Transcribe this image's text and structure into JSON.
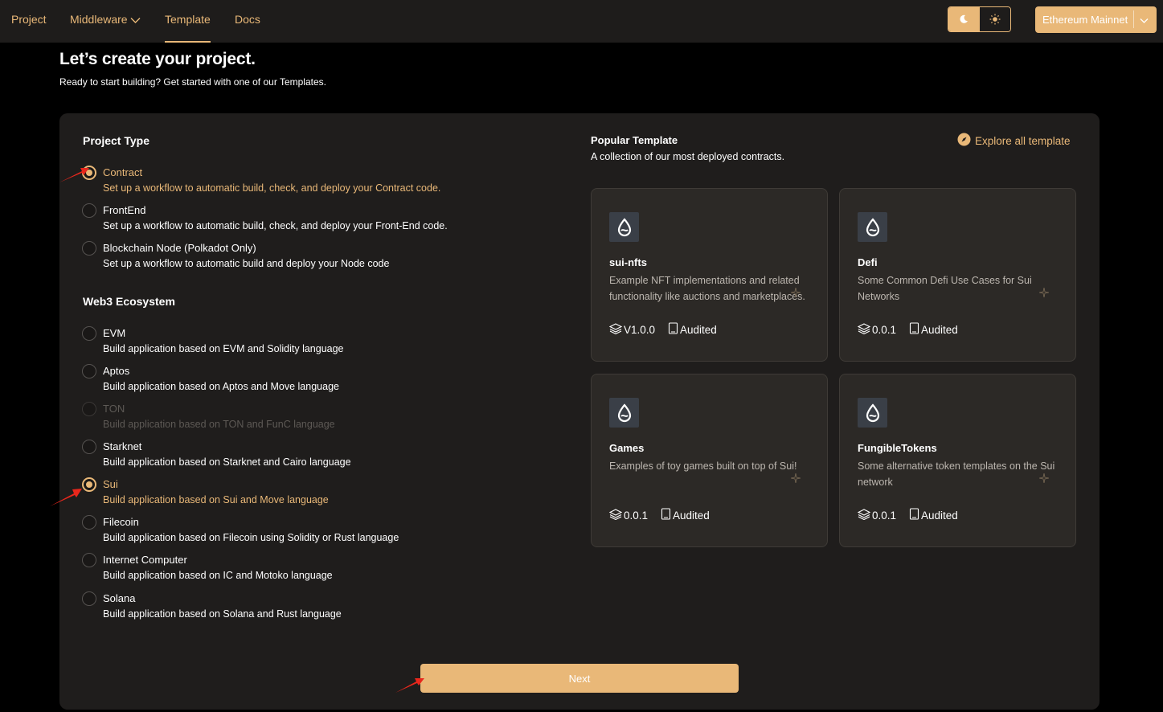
{
  "nav": {
    "items": [
      {
        "label": "Project",
        "active": false
      },
      {
        "label": "Middleware",
        "active": false,
        "has_dropdown": true
      },
      {
        "label": "Template",
        "active": true
      },
      {
        "label": "Docs",
        "active": false
      }
    ],
    "theme": {
      "moon_icon": "moon-icon",
      "sun_icon": "sun-icon",
      "selected": "dark"
    },
    "network": {
      "label": "Ethereum Mainnet"
    }
  },
  "header": {
    "title": "Let’s create your project.",
    "subtitle": "Ready to start building? Get started with one of our Templates."
  },
  "project_type": {
    "title": "Project Type",
    "options": [
      {
        "label": "Contract",
        "desc": "Set up a workflow to automatic build, check, and deploy your Contract code.",
        "selected": true
      },
      {
        "label": "FrontEnd",
        "desc": "Set up a workflow to automatic build, check, and deploy your Front-End code.",
        "selected": false
      },
      {
        "label": "Blockchain Node (Polkadot Only)",
        "desc": "Set up a workflow to automatic build and deploy your Node code",
        "selected": false
      }
    ]
  },
  "ecosystem": {
    "title": "Web3 Ecosystem",
    "options": [
      {
        "label": "EVM",
        "desc": "Build application based on EVM and Solidity language",
        "selected": false
      },
      {
        "label": "Aptos",
        "desc": "Build application based on Aptos and Move language",
        "selected": false
      },
      {
        "label": "TON",
        "desc": "Build application based on TON and FunC language",
        "selected": false,
        "disabled": true
      },
      {
        "label": "Starknet",
        "desc": "Build application based on Starknet and Cairo language",
        "selected": false
      },
      {
        "label": "Sui",
        "desc": "Build application based on Sui and Move language",
        "selected": true
      },
      {
        "label": "Filecoin",
        "desc": "Build application based on Filecoin using Solidity or Rust language",
        "selected": false
      },
      {
        "label": "Internet Computer",
        "desc": "Build application based on IC and Motoko language",
        "selected": false
      },
      {
        "label": "Solana",
        "desc": "Build application based on Solana and Rust language",
        "selected": false
      }
    ]
  },
  "templates": {
    "title": "Popular Template",
    "subtitle": "A collection of our most deployed contracts.",
    "explore_label": "Explore all template",
    "cards": [
      {
        "name": "sui-nfts",
        "desc": "Example NFT implementations and related functionality like auctions and marketplaces.",
        "version": "V1.0.0",
        "status": "Audited",
        "icon": "sui-drop-icon"
      },
      {
        "name": "Defi",
        "desc": "Some Common Defi Use Cases for Sui Networks",
        "version": "0.0.1",
        "status": "Audited",
        "icon": "sui-drop-icon"
      },
      {
        "name": "Games",
        "desc": "Examples of toy games built on top of Sui!",
        "version": "0.0.1",
        "status": "Audited",
        "icon": "sui-drop-icon"
      },
      {
        "name": "FungibleTokens",
        "desc": "Some alternative token templates on the Sui network",
        "version": "0.0.1",
        "status": "Audited",
        "icon": "sui-drop-icon"
      }
    ]
  },
  "actions": {
    "next_label": "Next"
  },
  "colors": {
    "accent": "#e9b878",
    "panel": "#1f1d1c",
    "card": "#2c2926",
    "annotation_arrow": "#e8271c"
  }
}
